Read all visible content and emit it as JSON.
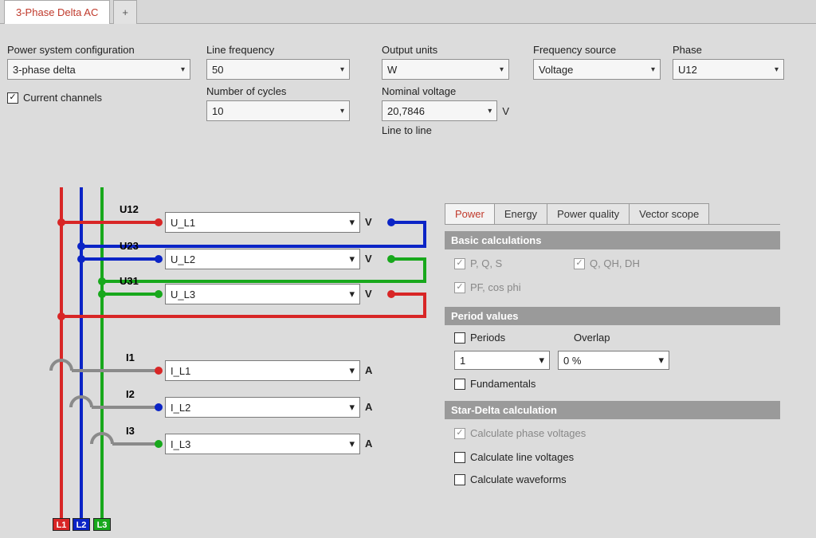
{
  "tabs": {
    "main": "3-Phase Delta AC",
    "add": "+"
  },
  "config": {
    "sysconfig_label": "Power system configuration",
    "sysconfig_value": "3-phase delta",
    "linefreq_label": "Line frequency",
    "linefreq_value": "50",
    "cycles_label": "Number of cycles",
    "cycles_value": "10",
    "outunits_label": "Output units",
    "outunits_value": "W",
    "nomvolt_label": "Nominal voltage",
    "nomvolt_value": "20,7846",
    "nomvolt_unit": "V",
    "nomvolt_hint": "Line to line",
    "freqsrc_label": "Frequency source",
    "freqsrc_value": "Voltage",
    "phase_label": "Phase",
    "phase_value": "U12",
    "current_channels": "Current channels"
  },
  "channels": {
    "u12_label": "U12",
    "u12_value": "U_L1",
    "u23_label": "U23",
    "u23_value": "U_L2",
    "u31_label": "U31",
    "u31_value": "U_L3",
    "i1_label": "I1",
    "i1_value": "I_L1",
    "i2_label": "I2",
    "i2_value": "I_L2",
    "i3_label": "I3",
    "i3_value": "I_L3",
    "volt_unit": "V",
    "amp_unit": "A"
  },
  "phasebadge": {
    "l1": "L1",
    "l2": "L2",
    "l3": "L3"
  },
  "subtabs": {
    "power": "Power",
    "energy": "Energy",
    "quality": "Power quality",
    "vector": "Vector scope"
  },
  "sections": {
    "basic": "Basic calculations",
    "period": "Period values",
    "stardelta": "Star-Delta calculation"
  },
  "basic": {
    "pqs": "P, Q, S",
    "pf": "PF, cos phi",
    "qqh": "Q, QH, DH"
  },
  "period": {
    "periods_label": "Periods",
    "periods_value": "1",
    "overlap_label": "Overlap",
    "overlap_value": "0 %",
    "fundamentals": "Fundamentals"
  },
  "stardelta": {
    "phase_v": "Calculate phase voltages",
    "line_v": "Calculate line voltages",
    "waveforms": "Calculate waveforms"
  }
}
